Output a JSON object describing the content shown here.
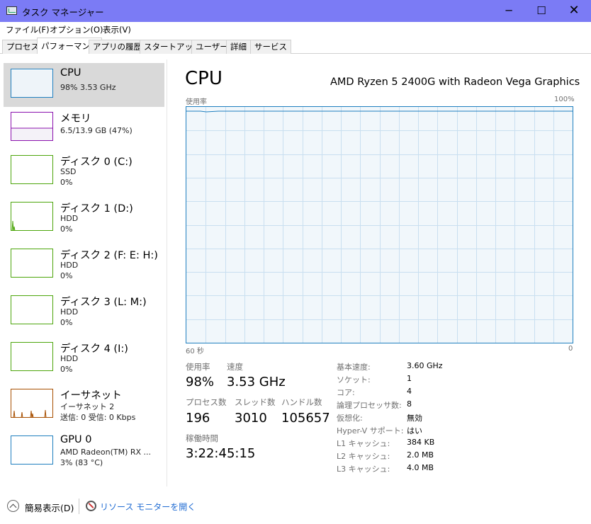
{
  "window": {
    "title": "タスク マネージャー",
    "controls": {
      "minimize": "─",
      "maximize": "☐",
      "close": "✕"
    }
  },
  "menu": [
    "ファイル(F)",
    "オプション(O)",
    "表示(V)"
  ],
  "tabs": [
    "プロセス",
    "パフォーマンス",
    "アプリの履歴",
    "スタートアップ",
    "ユーザー",
    "詳細",
    "サービス"
  ],
  "active_tab": "パフォーマンス",
  "sidebar": {
    "items": [
      {
        "name": "CPU",
        "lines": [
          "98%  3.53 GHz"
        ],
        "color": "#1f7fbf",
        "selected": true
      },
      {
        "name": "メモリ",
        "lines": [
          "6.5/13.9 GB (47%)"
        ],
        "color": "#8b12ae",
        "level": 0.47
      },
      {
        "name": "ディスク 0 (C:)",
        "lines": [
          "SSD",
          "0%"
        ],
        "color": "#4da60c"
      },
      {
        "name": "ディスク 1 (D:)",
        "lines": [
          "HDD",
          "0%"
        ],
        "color": "#4da60c"
      },
      {
        "name": "ディスク 2 (F: E: H:)",
        "lines": [
          "HDD",
          "0%"
        ],
        "color": "#4da60c"
      },
      {
        "name": "ディスク 3 (L: M:)",
        "lines": [
          "HDD",
          "0%"
        ],
        "color": "#4da60c"
      },
      {
        "name": "ディスク 4 (I:)",
        "lines": [
          "HDD",
          "0%"
        ],
        "color": "#4da60c"
      },
      {
        "name": "イーサネット",
        "lines": [
          "イーサネット 2",
          "送信: 0 受信: 0 Kbps"
        ],
        "color": "#a74f01"
      },
      {
        "name": "GPU 0",
        "lines": [
          "AMD Radeon(TM) RX ...",
          "3% (83 °C)"
        ],
        "color": "#1f7fbf"
      }
    ]
  },
  "main": {
    "title": "CPU",
    "model": "AMD Ryzen 5 2400G with Radeon Vega Graphics",
    "graph": {
      "label_top_left": "使用率",
      "label_top_right": "100%",
      "label_bottom_left": "60 秒",
      "label_bottom_right": "0",
      "color": "#1f7fbf",
      "grid_color": "#c9dff0"
    },
    "stats": {
      "utilization_label": "使用率",
      "utilization_value": "98%",
      "speed_label": "速度",
      "speed_value": "3.53 GHz",
      "processes_label": "プロセス数",
      "processes_value": "196",
      "threads_label": "スレッド数",
      "threads_value": "3010",
      "handles_label": "ハンドル数",
      "handles_value": "105657",
      "uptime_label": "稼働時間",
      "uptime_value": "3:22:45:15"
    },
    "specs": [
      {
        "label": "基本速度:",
        "value": "3.60 GHz"
      },
      {
        "label": "ソケット:",
        "value": "1"
      },
      {
        "label": "コア:",
        "value": "4"
      },
      {
        "label": "論理プロセッサ数:",
        "value": "8"
      },
      {
        "label": "仮想化:",
        "value": "無効"
      },
      {
        "label": "Hyper-V サポート:",
        "value": "はい"
      },
      {
        "label": "L1 キャッシュ:",
        "value": "384 KB"
      },
      {
        "label": "L2 キャッシュ:",
        "value": "2.0 MB"
      },
      {
        "label": "L3 キャッシュ:",
        "value": "4.0 MB"
      }
    ]
  },
  "footer": {
    "fewer_details": "簡易表示(D)",
    "resource_monitor": "リソース モニターを開く"
  }
}
